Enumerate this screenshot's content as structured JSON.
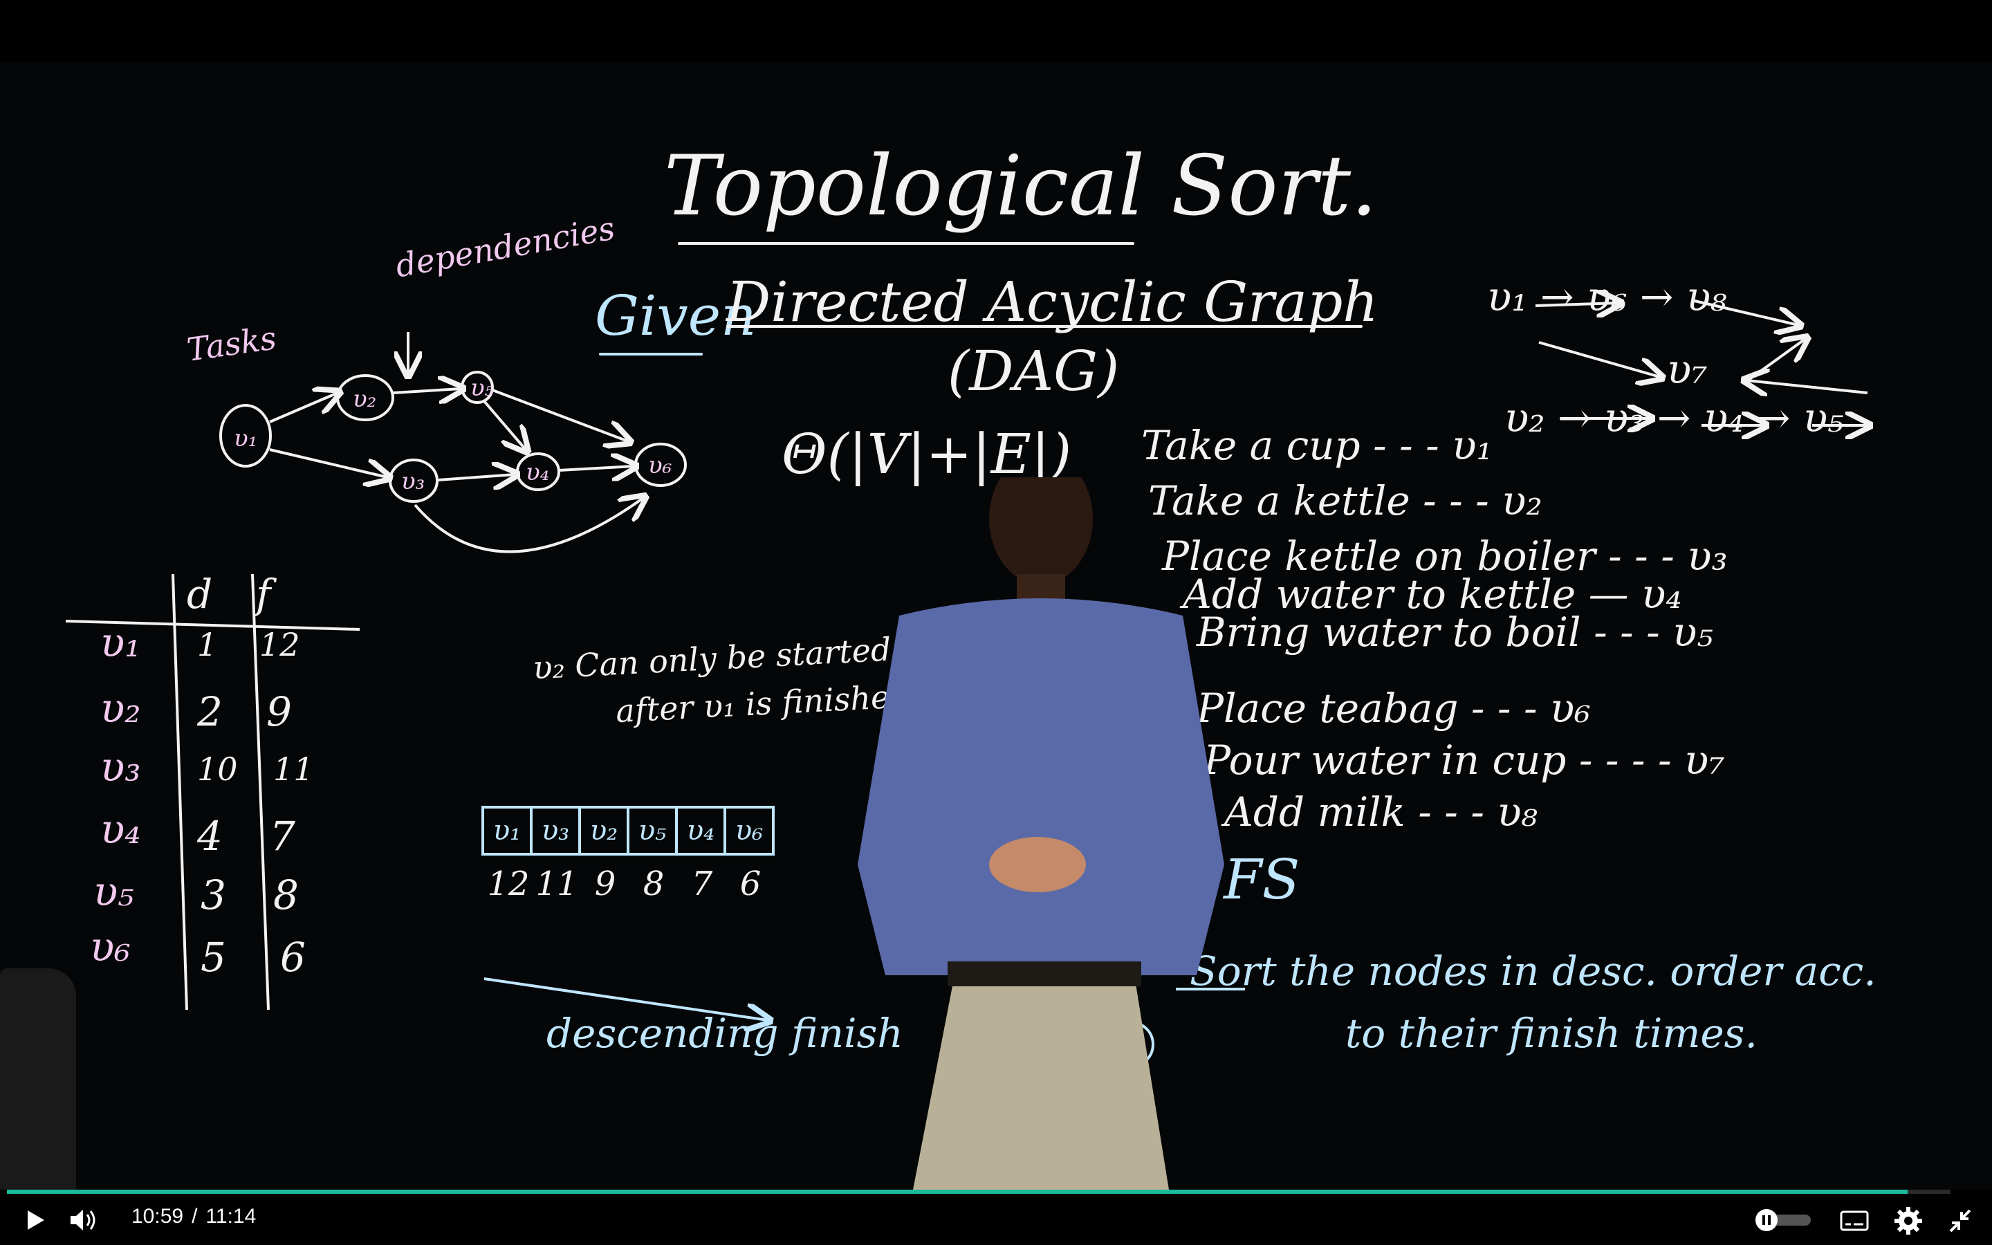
{
  "board": {
    "title": "Topological Sort.",
    "given": "Given",
    "dag_line": "Directed    Acyclic Graph",
    "dag_abbrev": "(DAG)",
    "complexity": "Θ(|V|+|E|)",
    "dependencies": "dependencies",
    "tasks": "Tasks",
    "note_line1": "υ₂ Can only be started",
    "note_line2": "after υ₁ is finished",
    "table_headers": [
      "d",
      "f"
    ],
    "table_rows": [
      {
        "v": "υ₁",
        "d": "1",
        "f": "12"
      },
      {
        "v": "υ₂",
        "d": "2",
        "f": "9"
      },
      {
        "v": "υ₃",
        "d": "10",
        "f": "11"
      },
      {
        "v": "υ₄",
        "d": "4",
        "f": "7"
      },
      {
        "v": "υ₅",
        "d": "3",
        "f": "8"
      },
      {
        "v": "υ₆",
        "d": "5",
        "f": "6"
      }
    ],
    "sorted_nodes": [
      "υ₁",
      "υ₃",
      "υ₂",
      "υ₅",
      "υ₄",
      "υ₆"
    ],
    "sorted_finish": [
      "12",
      "11",
      "9",
      "8",
      "7",
      "6"
    ],
    "descending_label": "descending finish",
    "tasks_list": [
      "Take a cup - - - υ₁",
      "Take a kettle - - - υ₂",
      "Place kettle on boiler - - - υ₃",
      "Add water to kettle — υ₄",
      "Bring water to boil - - - υ₅",
      "Place teabag - - - υ₆",
      "Pour water in cup - - - - υ₇",
      "Add milk - - - υ₈"
    ],
    "step1": "DFS",
    "step2_line1": "Sort the nodes in desc. order acc.",
    "step2_line2": "to their finish times.",
    "graph2_row1": "υ₁ → υ₆ → υ₈",
    "graph2_mid": "υ₇",
    "graph2_row2": "υ₂ → υ₃ → υ₄ → υ₅"
  },
  "player": {
    "current_time": "10:59",
    "separator": "/",
    "duration": "11:14",
    "progress": 0.978
  },
  "colors": {
    "progress": "#1abc9c",
    "chalk_white": "#f2f2f2",
    "chalk_pink": "#f2c9ef",
    "chalk_blue": "#bfe6ff"
  }
}
